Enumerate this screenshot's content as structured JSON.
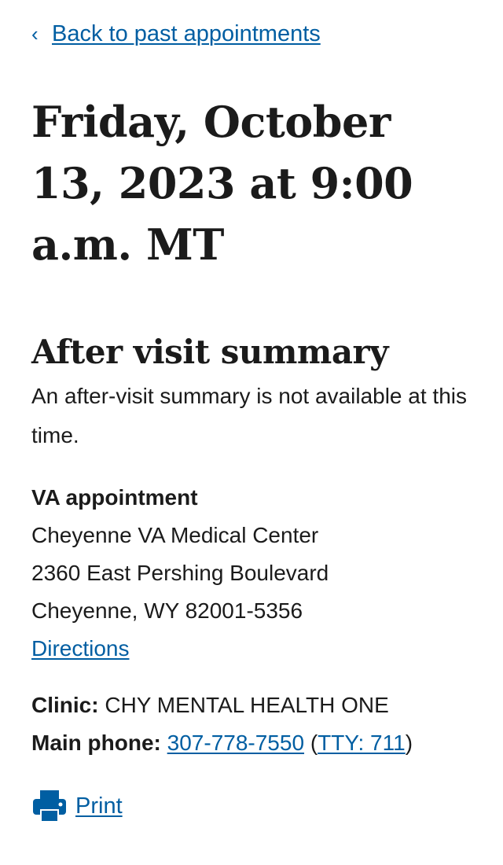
{
  "nav": {
    "back_chevron": "‹",
    "back_label": "Back to past appointments"
  },
  "appointment": {
    "datetime_heading": "Friday, October 13, 2023 at 9:00 a.m. MT"
  },
  "after_visit_summary": {
    "heading": "After visit summary",
    "message": "An after-visit summary is not available at this time."
  },
  "location": {
    "type_label": "VA appointment",
    "facility_name": "Cheyenne VA Medical Center",
    "street": "2360 East Pershing Boulevard",
    "city_state_zip": "Cheyenne, WY 82001-5356",
    "directions_label": "Directions"
  },
  "clinic": {
    "label": "Clinic:",
    "value": "CHY MENTAL HEALTH ONE"
  },
  "phone": {
    "label": "Main phone:",
    "number": "307-778-7550",
    "open_paren": "(",
    "tty_label": "TTY: 711",
    "close_paren": ")"
  },
  "actions": {
    "print_label": "Print",
    "print_icon": "printer-icon"
  },
  "colors": {
    "link": "#005ea2",
    "text": "#1b1b1b",
    "background": "#ffffff"
  }
}
